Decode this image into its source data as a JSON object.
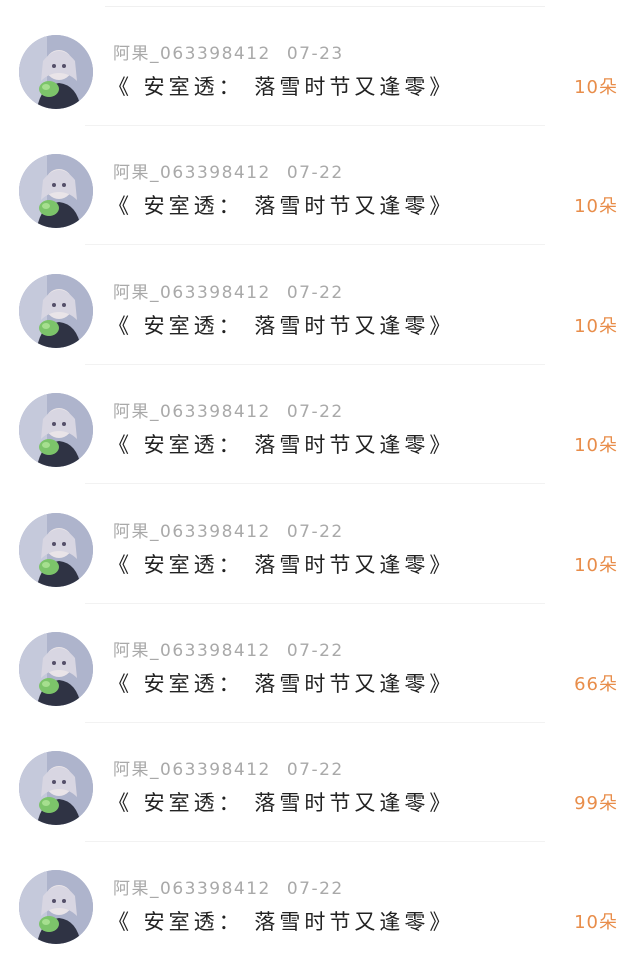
{
  "items": [
    {
      "username": "阿果_063398412",
      "date": "07-23",
      "title": "《 安室透： 落雪时节又逢零》",
      "gift": "10朵"
    },
    {
      "username": "阿果_063398412",
      "date": "07-22",
      "title": "《 安室透： 落雪时节又逢零》",
      "gift": "10朵"
    },
    {
      "username": "阿果_063398412",
      "date": "07-22",
      "title": "《 安室透： 落雪时节又逢零》",
      "gift": "10朵"
    },
    {
      "username": "阿果_063398412",
      "date": "07-22",
      "title": "《 安室透： 落雪时节又逢零》",
      "gift": "10朵"
    },
    {
      "username": "阿果_063398412",
      "date": "07-22",
      "title": "《 安室透： 落雪时节又逢零》",
      "gift": "10朵"
    },
    {
      "username": "阿果_063398412",
      "date": "07-22",
      "title": "《 安室透： 落雪时节又逢零》",
      "gift": "66朵"
    },
    {
      "username": "阿果_063398412",
      "date": "07-22",
      "title": "《 安室透： 落雪时节又逢零》",
      "gift": "99朵"
    },
    {
      "username": "阿果_063398412",
      "date": "07-22",
      "title": "《 安室透： 落雪时节又逢零》",
      "gift": "10朵"
    }
  ],
  "colors": {
    "gift_accent": "#e88d4a",
    "meta_text": "#a9a9a9",
    "title_text": "#222222"
  },
  "icons": {
    "avatar": "avatar-anime-girl-icon"
  }
}
